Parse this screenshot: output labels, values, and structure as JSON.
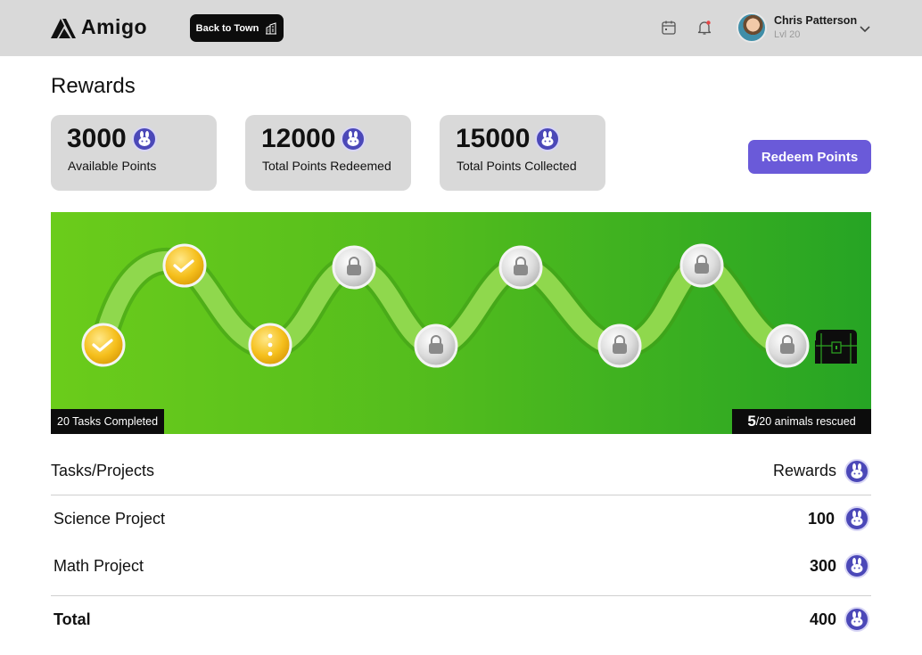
{
  "header": {
    "brand": "Amigo",
    "back_label": "Back to Town",
    "user_name": "Chris Patterson",
    "user_level": "Lvl 20"
  },
  "page": {
    "title": "Rewards"
  },
  "stats": [
    {
      "value": "3000",
      "label": "Available Points"
    },
    {
      "value": "12000",
      "label": "Total Points Redeemed"
    },
    {
      "value": "15000",
      "label": "Total Points Collected"
    }
  ],
  "redeem_label": "Redeem Points",
  "map": {
    "tasks_completed": "20 Tasks Completed",
    "rescued_count": "5",
    "rescued_total": "/20 animals rescued",
    "nodes": [
      "completed",
      "completed",
      "in-progress",
      "locked",
      "locked",
      "locked",
      "locked",
      "locked",
      "locked"
    ]
  },
  "table": {
    "col_task": "Tasks/Projects",
    "col_reward": "Rewards",
    "rows": [
      {
        "name": "Science Project",
        "points": "100"
      },
      {
        "name": "Math Project",
        "points": "300"
      }
    ],
    "total_label": "Total",
    "total_points": "400"
  },
  "colors": {
    "accent": "#6a5ad9",
    "coin": "#4b48b8",
    "map_left": "#6bcc1b",
    "map_right": "#26a424"
  },
  "icons": {
    "logo": "mountain-logo-icon",
    "back": "building-icon",
    "calendar": "calendar-icon",
    "bell": "bell-icon",
    "chevron": "chevron-down-icon",
    "coin": "bunny-coin-icon",
    "chest": "treasure-chest-icon"
  }
}
